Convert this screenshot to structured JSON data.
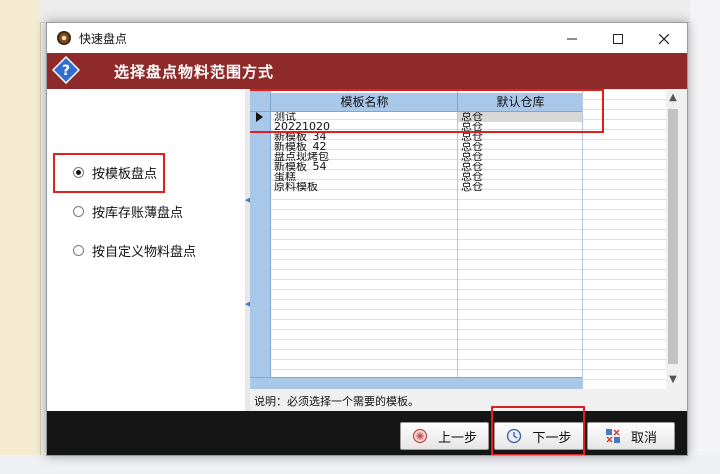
{
  "dialog": {
    "title": "快速盘点",
    "banner_title": "选择盘点物料范围方式"
  },
  "options": [
    {
      "label": "按模板盘点",
      "checked": true
    },
    {
      "label": "按库存账薄盘点",
      "checked": false
    },
    {
      "label": "按自定义物料盘点",
      "checked": false
    }
  ],
  "grid": {
    "columns": [
      "模板名称",
      "默认仓库"
    ],
    "rows": [
      {
        "name": "测试",
        "warehouse": "总仓",
        "selected": true
      },
      {
        "name": "20221020",
        "warehouse": "总仓"
      },
      {
        "name": "新模板_34",
        "warehouse": "总仓"
      },
      {
        "name": "新模板_42",
        "warehouse": "总仓"
      },
      {
        "name": "盘点现烤包",
        "warehouse": "总仓"
      },
      {
        "name": "新模板_54",
        "warehouse": "总仓"
      },
      {
        "name": "蛋糕",
        "warehouse": "总仓"
      },
      {
        "name": "原料模板",
        "warehouse": "总仓"
      }
    ]
  },
  "hint": "说明：必须选择一个需要的模板。",
  "buttons": {
    "prev": "上一步",
    "next": "下一步",
    "cancel": "取消"
  },
  "colors": {
    "banner": "#8e2a2a",
    "highlight": "#e02020",
    "grid_header": "#a9c8e9",
    "button_bar": "#151515"
  }
}
